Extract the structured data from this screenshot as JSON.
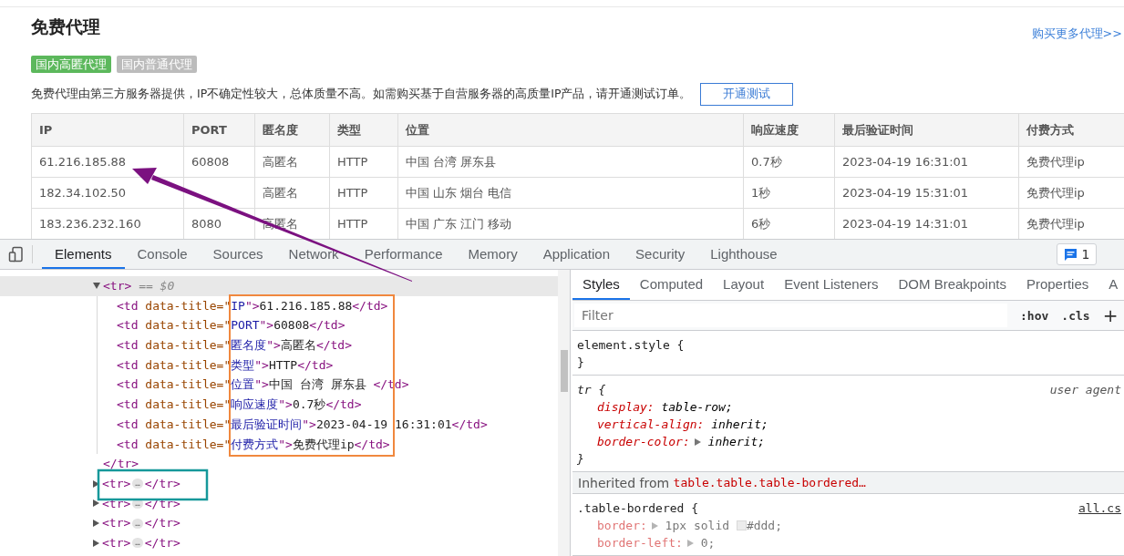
{
  "page": {
    "title": "免费代理",
    "more_link": "购买更多代理>>",
    "tabs": [
      {
        "label": "国内高匿代理",
        "selected": true
      },
      {
        "label": "国内普通代理",
        "selected": false
      }
    ],
    "notice": "免费代理由第三方服务器提供，IP不确定性较大，总体质量不高。如需购买基于自营服务器的高质量IP产品，请开通测试订单。",
    "test_button": "开通测试",
    "table": {
      "columns": [
        "IP",
        "PORT",
        "匿名度",
        "类型",
        "位置",
        "响应速度",
        "最后验证时间",
        "付费方式"
      ],
      "rows": [
        [
          "61.216.185.88",
          "60808",
          "高匿名",
          "HTTP",
          "中国 台湾 屏东县",
          "0.7秒",
          "2023-04-19 16:31:01",
          "免费代理ip"
        ],
        [
          "182.34.102.50",
          null,
          "高匿名",
          "HTTP",
          "中国 山东 烟台 电信",
          "1秒",
          "2023-04-19 15:31:01",
          "免费代理ip"
        ],
        [
          "183.236.232.160",
          "8080",
          "高匿名",
          "HTTP",
          "中国 广东 江门 移动",
          "6秒",
          "2023-04-19 14:31:01",
          "免费代理ip"
        ]
      ]
    }
  },
  "devtools": {
    "tabs": [
      {
        "label": "Elements",
        "selected": true
      },
      {
        "label": "Console",
        "selected": false
      },
      {
        "label": "Sources",
        "selected": false
      },
      {
        "label": "Network",
        "selected": false
      },
      {
        "label": "Performance",
        "selected": false
      },
      {
        "label": "Memory",
        "selected": false
      },
      {
        "label": "Application",
        "selected": false
      },
      {
        "label": "Security",
        "selected": false
      },
      {
        "label": "Lighthouse",
        "selected": false
      }
    ],
    "issues_count": "1",
    "dom": {
      "nodes": [
        {
          "expanded": true,
          "selected": true,
          "tokens": [
            {
              "kind": "tag",
              "text": "<tr>"
            },
            {
              "kind": "marker",
              "text": " == $0"
            }
          ],
          "children": [
            {
              "tokens": [
                {
                  "kind": "tag",
                  "text": "<td "
                },
                {
                  "kind": "attr",
                  "text": "data-title=\""
                },
                {
                  "kind": "value",
                  "text": "IP"
                },
                {
                  "kind": "tag",
                  "text": "\">"
                },
                {
                  "kind": "text",
                  "text": "61.216.185.88"
                },
                {
                  "kind": "tag",
                  "text": "</td>"
                }
              ]
            },
            {
              "tokens": [
                {
                  "kind": "tag",
                  "text": "<td "
                },
                {
                  "kind": "attr",
                  "text": "data-title=\""
                },
                {
                  "kind": "value",
                  "text": "PORT"
                },
                {
                  "kind": "tag",
                  "text": "\">"
                },
                {
                  "kind": "text",
                  "text": "60808"
                },
                {
                  "kind": "tag",
                  "text": "</td>"
                }
              ]
            },
            {
              "tokens": [
                {
                  "kind": "tag",
                  "text": "<td "
                },
                {
                  "kind": "attr",
                  "text": "data-title=\""
                },
                {
                  "kind": "value",
                  "text": "匿名度"
                },
                {
                  "kind": "tag",
                  "text": "\">"
                },
                {
                  "kind": "text",
                  "text": "高匿名"
                },
                {
                  "kind": "tag",
                  "text": "</td>"
                }
              ]
            },
            {
              "tokens": [
                {
                  "kind": "tag",
                  "text": "<td "
                },
                {
                  "kind": "attr",
                  "text": "data-title=\""
                },
                {
                  "kind": "value",
                  "text": "类型"
                },
                {
                  "kind": "tag",
                  "text": "\">"
                },
                {
                  "kind": "text",
                  "text": "HTTP"
                },
                {
                  "kind": "tag",
                  "text": "</td>"
                }
              ]
            },
            {
              "tokens": [
                {
                  "kind": "tag",
                  "text": "<td "
                },
                {
                  "kind": "attr",
                  "text": "data-title=\""
                },
                {
                  "kind": "value",
                  "text": "位置"
                },
                {
                  "kind": "tag",
                  "text": "\">"
                },
                {
                  "kind": "text",
                  "text": "中国 台湾 屏东县 "
                },
                {
                  "kind": "tag",
                  "text": "</td>"
                }
              ]
            },
            {
              "tokens": [
                {
                  "kind": "tag",
                  "text": "<td "
                },
                {
                  "kind": "attr",
                  "text": "data-title=\""
                },
                {
                  "kind": "value",
                  "text": "响应速度"
                },
                {
                  "kind": "tag",
                  "text": "\">"
                },
                {
                  "kind": "text",
                  "text": "0.7秒"
                },
                {
                  "kind": "tag",
                  "text": "</td>"
                }
              ]
            },
            {
              "tokens": [
                {
                  "kind": "tag",
                  "text": "<td "
                },
                {
                  "kind": "attr",
                  "text": "data-title=\""
                },
                {
                  "kind": "value",
                  "text": "最后验证时间"
                },
                {
                  "kind": "tag",
                  "text": "\">"
                },
                {
                  "kind": "text",
                  "text": "2023-04-19 16:31:01"
                },
                {
                  "kind": "tag",
                  "text": "</td>"
                }
              ]
            },
            {
              "tokens": [
                {
                  "kind": "tag",
                  "text": "<td "
                },
                {
                  "kind": "attr",
                  "text": "data-title=\""
                },
                {
                  "kind": "value",
                  "text": "付费方式"
                },
                {
                  "kind": "tag",
                  "text": "\">"
                },
                {
                  "kind": "text",
                  "text": "免费代理ip"
                },
                {
                  "kind": "tag",
                  "text": "</td>"
                }
              ]
            }
          ],
          "closing": [
            {
              "kind": "tag",
              "text": "</tr>"
            }
          ]
        },
        {
          "expanded": false,
          "selected": false,
          "tokens": [
            {
              "kind": "tag",
              "text": "<tr>"
            },
            {
              "kind": "ellipsis",
              "text": "…"
            },
            {
              "kind": "tag",
              "text": "</tr>"
            }
          ]
        },
        {
          "expanded": false,
          "selected": false,
          "tokens": [
            {
              "kind": "tag",
              "text": "<tr>"
            },
            {
              "kind": "ellipsis",
              "text": "…"
            },
            {
              "kind": "tag",
              "text": "</tr>"
            }
          ]
        },
        {
          "expanded": false,
          "selected": false,
          "tokens": [
            {
              "kind": "tag",
              "text": "<tr>"
            },
            {
              "kind": "ellipsis",
              "text": "…"
            },
            {
              "kind": "tag",
              "text": "</tr>"
            }
          ]
        },
        {
          "expanded": false,
          "selected": false,
          "tokens": [
            {
              "kind": "tag",
              "text": "<tr>"
            },
            {
              "kind": "ellipsis",
              "text": "…"
            },
            {
              "kind": "tag",
              "text": "</tr>"
            }
          ]
        }
      ]
    },
    "styles": {
      "tabs": [
        {
          "label": "Styles",
          "selected": true
        },
        {
          "label": "Computed",
          "selected": false
        },
        {
          "label": "Layout",
          "selected": false
        },
        {
          "label": "Event Listeners",
          "selected": false
        },
        {
          "label": "DOM Breakpoints",
          "selected": false
        },
        {
          "label": "Properties",
          "selected": false
        },
        {
          "label": "A",
          "selected": false
        }
      ],
      "filter_placeholder": "Filter",
      "hov": ":hov",
      "cls": ".cls",
      "add": "+",
      "rules": [
        {
          "kind": "inline",
          "selector": "element.style",
          "open": " {",
          "close": "}"
        },
        {
          "kind": "user-agent",
          "selector": "tr",
          "open": " {",
          "close": "}",
          "source": "user agent",
          "declarations": [
            {
              "property": "display:",
              "value": " table-row;",
              "expandable": false,
              "dimmed": false
            },
            {
              "property": "vertical-align:",
              "value": " inherit;",
              "expandable": false,
              "dimmed": false
            },
            {
              "property": "border-color:",
              "value": " inherit;",
              "expandable": true,
              "dimmed": false
            }
          ]
        },
        {
          "kind": "inherited",
          "label": "Inherited from ",
          "selector": "table.table.table-bordered…"
        },
        {
          "kind": "author",
          "selector": ".table-bordered",
          "open": " {",
          "source": "all.cs",
          "declarations": [
            {
              "property": "border:",
              "value": " 1px solid ",
              "swatch_value": "#ddd;",
              "expandable": true,
              "dimmed": true
            },
            {
              "property": "border-left:",
              "value": " 0;",
              "expandable": true,
              "dimmed": true
            }
          ]
        }
      ]
    }
  }
}
